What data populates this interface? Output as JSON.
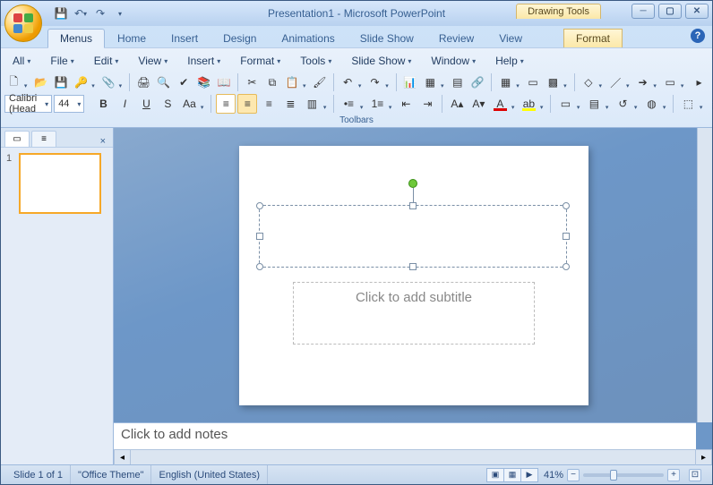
{
  "title": {
    "doc": "Presentation1",
    "app": "Microsoft PowerPoint",
    "context_tool": "Drawing Tools"
  },
  "tabs": {
    "items": [
      "Menus",
      "Home",
      "Insert",
      "Design",
      "Animations",
      "Slide Show",
      "Review",
      "View",
      "Format"
    ],
    "active": "Menus",
    "context_index": 8
  },
  "classic_menus": [
    "All",
    "File",
    "Edit",
    "View",
    "Insert",
    "Format",
    "Tools",
    "Slide Show",
    "Window",
    "Help"
  ],
  "toolbar_row1": [
    {
      "id": "new",
      "name": "new-icon",
      "glyph": "🗋",
      "dd": true
    },
    {
      "id": "open",
      "name": "open-icon",
      "glyph": "📂",
      "dd": false
    },
    {
      "id": "save",
      "name": "save-icon",
      "glyph": "💾",
      "dd": false
    },
    {
      "id": "permission",
      "name": "permission-icon",
      "glyph": "🔑",
      "dd": true
    },
    {
      "id": "attach",
      "name": "attach-icon",
      "glyph": "📎",
      "dd": true
    },
    {
      "id": "sep1",
      "sep": true
    },
    {
      "id": "print",
      "name": "print-icon",
      "glyph": "🖨",
      "dd": false
    },
    {
      "id": "preview",
      "name": "print-preview-icon",
      "glyph": "🔍",
      "dd": false
    },
    {
      "id": "spell",
      "name": "spellcheck-icon",
      "glyph": "✔",
      "dd": false
    },
    {
      "id": "research",
      "name": "research-icon",
      "glyph": "📚",
      "dd": false
    },
    {
      "id": "thesaurus",
      "name": "thesaurus-icon",
      "glyph": "📖",
      "dd": false
    },
    {
      "id": "sep2",
      "sep": true
    },
    {
      "id": "cut",
      "name": "cut-icon",
      "glyph": "✂",
      "dd": false
    },
    {
      "id": "copy",
      "name": "copy-icon",
      "glyph": "⧉",
      "dd": false
    },
    {
      "id": "paste",
      "name": "paste-icon",
      "glyph": "📋",
      "dd": true
    },
    {
      "id": "fmtpaint",
      "name": "format-painter-icon",
      "glyph": "🖌",
      "dd": false
    },
    {
      "id": "sep3",
      "sep": true
    },
    {
      "id": "undo",
      "name": "undo-icon",
      "glyph": "↶",
      "dd": true
    },
    {
      "id": "redo",
      "name": "redo-icon",
      "glyph": "↷",
      "dd": true
    },
    {
      "id": "sep4",
      "sep": true
    },
    {
      "id": "chart",
      "name": "chart-icon",
      "glyph": "📊",
      "dd": false
    },
    {
      "id": "table",
      "name": "table-icon",
      "glyph": "▦",
      "dd": true
    },
    {
      "id": "tableins",
      "name": "insert-table-icon",
      "glyph": "▤",
      "dd": false
    },
    {
      "id": "hyperlink",
      "name": "hyperlink-icon",
      "glyph": "🔗",
      "dd": false
    },
    {
      "id": "sep5",
      "sep": true
    },
    {
      "id": "tablefmt",
      "name": "table-format-icon",
      "glyph": "▦",
      "dd": true
    },
    {
      "id": "box",
      "name": "text-box-icon",
      "glyph": "▭",
      "dd": false
    },
    {
      "id": "grid",
      "name": "grid-icon",
      "glyph": "▩",
      "dd": true
    },
    {
      "id": "sep6",
      "sep": true
    },
    {
      "id": "shape1",
      "name": "shapes-icon",
      "glyph": "◇",
      "dd": true
    },
    {
      "id": "shape2",
      "name": "line-icon",
      "glyph": "／",
      "dd": true
    },
    {
      "id": "shape3",
      "name": "arrow-icon",
      "glyph": "➔",
      "dd": true
    },
    {
      "id": "shape4",
      "name": "rect-icon",
      "glyph": "▭",
      "dd": true
    },
    {
      "id": "spacer",
      "spacer": true
    },
    {
      "id": "expand",
      "name": "expand-icon",
      "glyph": "▸",
      "dd": false
    }
  ],
  "font": {
    "family": "Calibri (Head",
    "size": "44"
  },
  "toolbar_row2": [
    {
      "id": "bold",
      "name": "bold-icon",
      "glyph": "B",
      "style": "font-weight:bold"
    },
    {
      "id": "italic",
      "name": "italic-icon",
      "glyph": "I",
      "style": "font-style:italic"
    },
    {
      "id": "underline",
      "name": "underline-icon",
      "glyph": "U",
      "style": "text-decoration:underline"
    },
    {
      "id": "shadow",
      "name": "text-shadow-icon",
      "glyph": "S"
    },
    {
      "id": "changecase",
      "name": "change-case-icon",
      "glyph": "Aa",
      "dd": true
    },
    {
      "id": "sepA",
      "sep": true
    },
    {
      "id": "alignl",
      "name": "align-left-icon",
      "glyph": "≡",
      "bg": "#fff"
    },
    {
      "id": "alignc",
      "name": "align-center-icon",
      "glyph": "≡",
      "bg": "#fde8b0"
    },
    {
      "id": "alignr",
      "name": "align-right-icon",
      "glyph": "≡"
    },
    {
      "id": "alignj",
      "name": "align-justify-icon",
      "glyph": "≣"
    },
    {
      "id": "cols",
      "name": "columns-icon",
      "glyph": "▥",
      "dd": true
    },
    {
      "id": "sepB",
      "sep": true
    },
    {
      "id": "bullets",
      "name": "bullets-icon",
      "glyph": "•≡",
      "dd": true
    },
    {
      "id": "numbers",
      "name": "numbering-icon",
      "glyph": "1≡",
      "dd": true
    },
    {
      "id": "outdent",
      "name": "decrease-indent-icon",
      "glyph": "⇤"
    },
    {
      "id": "indent",
      "name": "increase-indent-icon",
      "glyph": "⇥"
    },
    {
      "id": "sepC",
      "sep": true
    },
    {
      "id": "growfont",
      "name": "grow-font-icon",
      "glyph": "A▴"
    },
    {
      "id": "shrinkfont",
      "name": "shrink-font-icon",
      "glyph": "A▾"
    },
    {
      "id": "fontcolor",
      "name": "font-color-icon",
      "glyph": "A",
      "dd": true,
      "underline_color": "#d00"
    },
    {
      "id": "highlight",
      "name": "highlight-icon",
      "glyph": "ab",
      "dd": true,
      "underline_color": "#ff0"
    },
    {
      "id": "sepD",
      "sep": true
    },
    {
      "id": "newslide",
      "name": "new-slide-icon",
      "glyph": "▭",
      "dd": true
    },
    {
      "id": "layout",
      "name": "layout-icon",
      "glyph": "▤",
      "dd": true
    },
    {
      "id": "reset",
      "name": "reset-icon",
      "glyph": "↺",
      "dd": true
    },
    {
      "id": "shapefill",
      "name": "shape-fill-icon",
      "glyph": "◍",
      "dd": true
    },
    {
      "id": "sepE",
      "sep": true
    },
    {
      "id": "arrange",
      "name": "arrange-icon",
      "glyph": "⬚",
      "dd": true
    },
    {
      "id": "group",
      "name": "group-icon",
      "glyph": "⬚",
      "dd": true
    },
    {
      "id": "rotate",
      "name": "rotate-icon",
      "glyph": "⟳",
      "dd": true
    }
  ],
  "ribbon_group_label": "Toolbars",
  "slide": {
    "subtitle_placeholder": "Click to add subtitle",
    "notes_placeholder": "Click to add notes",
    "thumb_number": "1"
  },
  "status": {
    "slide_info": "Slide 1 of 1",
    "theme": "\"Office Theme\"",
    "language": "English (United States)",
    "zoom": "41%"
  }
}
